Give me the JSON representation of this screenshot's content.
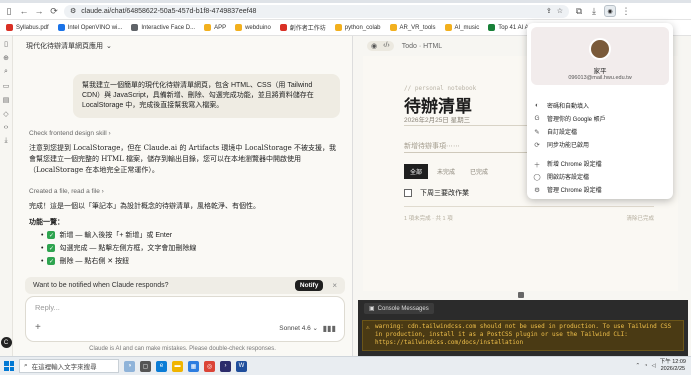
{
  "browser": {
    "url": "claude.ai/chat/64858622-50a5-457d-b1f8-4749837eef48",
    "bookmarks": [
      {
        "label": "Syllabus.pdf",
        "color": "#d93025"
      },
      {
        "label": "Intel OpenVINO wi...",
        "color": "#1a73e8"
      },
      {
        "label": "Interactive Face D...",
        "color": "#5f6368"
      },
      {
        "label": "APP",
        "color": "#f2b01e"
      },
      {
        "label": "webduino",
        "color": "#f2b01e"
      },
      {
        "label": "創作者工作坊",
        "color": "#d93025"
      },
      {
        "label": "python_colab",
        "color": "#f2b01e"
      },
      {
        "label": "AR_VR_tools",
        "color": "#f2b01e"
      },
      {
        "label": "AI_music",
        "color": "#f2b01e"
      },
      {
        "label": "Top 41 AI Art...",
        "color": "#188038"
      }
    ]
  },
  "chat": {
    "title": "現代化待辦清單網頁應用",
    "user_message": "幫我建立一個簡單的現代化待辦清單網頁，包含 HTML、CSS（用 Tailwind CDN）與 JavaScript，具備新增、刪除、勾選完成功能，並且將資料儲存在 LocalStorage 中，完成後直接幫我寫入檔案。",
    "tool_line_1": "Check frontend design skill ›",
    "assistant_intro": "注意到您提到 LocalStorage，但在 Claude.ai 的 Artifacts 環境中 LocalStorage 不被支援，我會幫您建立一個完整的 HTML 檔案，儲存到輸出目錄，您可以在本地瀏覽器中開啟使用（LocalStorage 在本地完全正常運作）。",
    "tool_line_2": "Created a file, read a file ›",
    "assistant_done": "完成！這是一個以「筆記本」為設計概念的待辦清單，風格乾淨、有個性。",
    "features_title": "功能一覽：",
    "features": [
      "新增 — 輸入後按「+ 新增」或 Enter",
      "勾選完成 — 點擊左側方框，文字會加刪除線",
      "刪除 — 點右側 ✕ 按鈕"
    ],
    "notify_text": "Want to be notified when Claude responds?",
    "notify_button": "Notify",
    "reply_placeholder": "Reply...",
    "model": "Sonnet 4.6",
    "disclaimer": "Claude is AI and can make mistakes. Please double-check responses."
  },
  "artifact": {
    "header": "Todo · HTML",
    "kicker": "// personal notebook",
    "title": "待辦清單",
    "date": "2026年2月25日 星期三",
    "input_placeholder": "新增待辦事項⋯⋯",
    "filters": [
      "全部",
      "未完成",
      "已完成"
    ],
    "active_filter": "全部",
    "items": [
      {
        "text": "下周三要改作業",
        "done": false
      }
    ],
    "footer_left": "1 項未完成 · 共 1 項",
    "footer_right": "清除已完成"
  },
  "console": {
    "tab": "Console Messages",
    "warning": "warning: cdn.tailwindcss.com should not be used in production. To use Tailwind CSS in production, install it as a PostCSS plugin or use the Tailwind CLI: https://tailwindcss.com/docs/installation"
  },
  "profile_menu": {
    "name": "家平",
    "email": "096013@mail.hwu.edu.tw",
    "items_1": [
      {
        "icon": "palette-icon",
        "glyph": "◐",
        "label": "密碼和自動填入"
      },
      {
        "icon": "google-icon",
        "glyph": "G",
        "label": "管理你的 Google 帳戶"
      },
      {
        "icon": "customize-icon",
        "glyph": "✎",
        "label": "自訂設定檔"
      },
      {
        "icon": "sync-icon",
        "glyph": "⟳",
        "label": "同步功能已啟用"
      }
    ],
    "items_2": [
      {
        "icon": "add-profile-icon",
        "glyph": "＋",
        "label": "新增 Chrome 設定檔"
      },
      {
        "icon": "guest-icon",
        "glyph": "◯",
        "label": "開啟訪客設定檔"
      },
      {
        "icon": "manage-profiles-icon",
        "glyph": "⚙",
        "label": "管理 Chrome 設定檔"
      }
    ]
  },
  "taskbar": {
    "search_placeholder": "在這裡輸入文字來搜尋",
    "time": "下午 12:09",
    "date": "2026/2/25"
  }
}
